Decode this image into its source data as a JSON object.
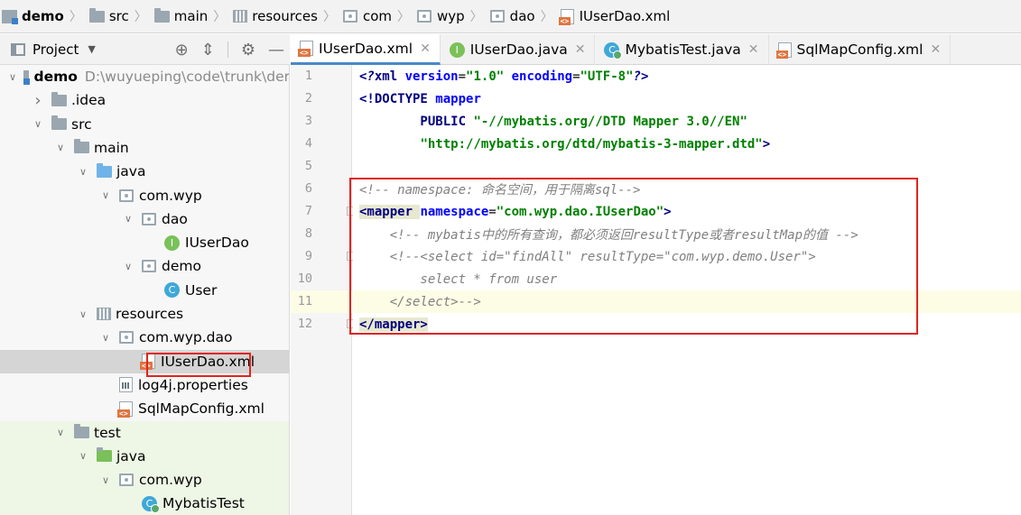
{
  "breadcrumb": [
    {
      "label": "demo",
      "icon": "module-icon"
    },
    {
      "label": "src",
      "icon": "folder-icon"
    },
    {
      "label": "main",
      "icon": "folder-icon"
    },
    {
      "label": "resources",
      "icon": "resources-folder-icon"
    },
    {
      "label": "com",
      "icon": "package-icon"
    },
    {
      "label": "wyp",
      "icon": "package-icon"
    },
    {
      "label": "dao",
      "icon": "package-icon"
    },
    {
      "label": "IUserDao.xml",
      "icon": "xml-file-icon"
    }
  ],
  "project_panel": {
    "title": "Project",
    "tools": [
      "locate-icon",
      "collapse-icon",
      "gear-icon",
      "minimize-icon"
    ]
  },
  "tree": [
    {
      "label": "demo",
      "path": "D:\\wuyueping\\code\\trunk\\der",
      "icon": "module-icon",
      "expanded": true
    },
    {
      "label": ".idea",
      "icon": "folder-icon",
      "expanded": false
    },
    {
      "label": "src",
      "icon": "folder-icon",
      "expanded": true
    },
    {
      "label": "main",
      "icon": "folder-icon",
      "expanded": true
    },
    {
      "label": "java",
      "icon": "source-folder-icon",
      "expanded": true
    },
    {
      "label": "com.wyp",
      "icon": "package-icon",
      "expanded": true
    },
    {
      "label": "dao",
      "icon": "package-icon",
      "expanded": true
    },
    {
      "label": "IUserDao",
      "icon": "interface-icon"
    },
    {
      "label": "demo",
      "icon": "package-icon",
      "expanded": true
    },
    {
      "label": "User",
      "icon": "class-icon"
    },
    {
      "label": "resources",
      "icon": "resources-folder-icon",
      "expanded": true
    },
    {
      "label": "com.wyp.dao",
      "icon": "package-icon",
      "expanded": true
    },
    {
      "label": "IUserDao.xml",
      "icon": "xml-file-icon",
      "selected": true
    },
    {
      "label": "log4j.properties",
      "icon": "properties-file-icon"
    },
    {
      "label": "SqlMapConfig.xml",
      "icon": "xml-file-icon"
    },
    {
      "label": "test",
      "icon": "folder-icon",
      "expanded": true
    },
    {
      "label": "java",
      "icon": "test-source-folder-icon",
      "expanded": true
    },
    {
      "label": "com.wyp",
      "icon": "package-icon",
      "expanded": true
    },
    {
      "label": "MybatisTest",
      "icon": "test-class-icon"
    }
  ],
  "tabs": [
    {
      "label": "IUserDao.xml",
      "icon": "xml-file-icon",
      "active": true
    },
    {
      "label": "IUserDao.java",
      "icon": "interface-icon",
      "active": false
    },
    {
      "label": "MybatisTest.java",
      "icon": "test-class-icon",
      "active": false
    },
    {
      "label": "SqlMapConfig.xml",
      "icon": "xml-file-icon",
      "active": false
    }
  ],
  "editor": {
    "line_numbers": [
      "1",
      "2",
      "3",
      "4",
      "5",
      "6",
      "7",
      "8",
      "9",
      "10",
      "11",
      "12"
    ],
    "lines": [
      [
        {
          "t": "<?",
          "c": "pi"
        },
        {
          "t": "xml ",
          "c": "tag"
        },
        {
          "t": "version",
          "c": "attr"
        },
        {
          "t": "=",
          "c": "plain"
        },
        {
          "t": "\"1.0\"",
          "c": "str"
        },
        {
          "t": " ",
          "c": "plain"
        },
        {
          "t": "encoding",
          "c": "attr"
        },
        {
          "t": "=",
          "c": "plain"
        },
        {
          "t": "\"UTF-8\"",
          "c": "str"
        },
        {
          "t": "?>",
          "c": "pi"
        }
      ],
      [
        {
          "t": "<!DOCTYPE ",
          "c": "tag"
        },
        {
          "t": "mapper",
          "c": "attr"
        }
      ],
      [
        {
          "t": "        PUBLIC ",
          "c": "tag"
        },
        {
          "t": "\"-//mybatis.org//DTD Mapper 3.0//EN\"",
          "c": "str"
        }
      ],
      [
        {
          "t": "        ",
          "c": "plain"
        },
        {
          "t": "\"http://mybatis.org/dtd/mybatis-3-mapper.dtd\"",
          "c": "str"
        },
        {
          "t": ">",
          "c": "tag"
        }
      ],
      [],
      [
        {
          "t": "<!-- namespace: 命名空间，用于隔离sql-->",
          "c": "com"
        }
      ],
      [
        {
          "t": "<mapper ",
          "c": "tag"
        },
        {
          "t": "namespace",
          "c": "attr"
        },
        {
          "t": "=",
          "c": "plain"
        },
        {
          "t": "\"com.wyp.dao.IUserDao\"",
          "c": "str"
        },
        {
          "t": ">",
          "c": "tag"
        }
      ],
      [
        {
          "t": "    <!-- mybatis中的所有查询，都必须返回resultType或者resultMap的值 -->",
          "c": "com"
        }
      ],
      [
        {
          "t": "    <!--<select id=\"findAll\" resultType=\"com.wyp.demo.User\">",
          "c": "com"
        }
      ],
      [
        {
          "t": "        select * from user",
          "c": "com"
        }
      ],
      [
        {
          "t": "    </select>-->",
          "c": "com"
        }
      ],
      [
        {
          "t": "</mapper>",
          "c": "tag"
        }
      ]
    ]
  },
  "colors": {
    "annotation_box": "#e0241e",
    "selection": "#d5d5d5",
    "tab_underline": "#4a88c7"
  }
}
